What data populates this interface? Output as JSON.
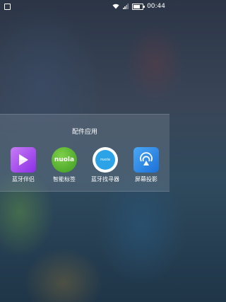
{
  "status_bar": {
    "time": "00:44",
    "left_icon": "screenshot-icon",
    "icons": [
      "wifi-icon",
      "signal-icon",
      "battery-icon"
    ]
  },
  "panel": {
    "title": "配件应用",
    "apps": [
      {
        "label": "蓝牙伴侣",
        "icon": "play-icon",
        "color": "#a64bf0"
      },
      {
        "label": "智能标签",
        "icon": "nuola-logo",
        "logo_text": "nuola",
        "color": "#55b52c"
      },
      {
        "label": "蓝牙找寻器",
        "icon": "finder-icon",
        "logo_text": "nuola",
        "color": "#2ba3e6"
      },
      {
        "label": "屏幕投影",
        "icon": "cast-icon",
        "color": "#2b86e6"
      }
    ]
  }
}
